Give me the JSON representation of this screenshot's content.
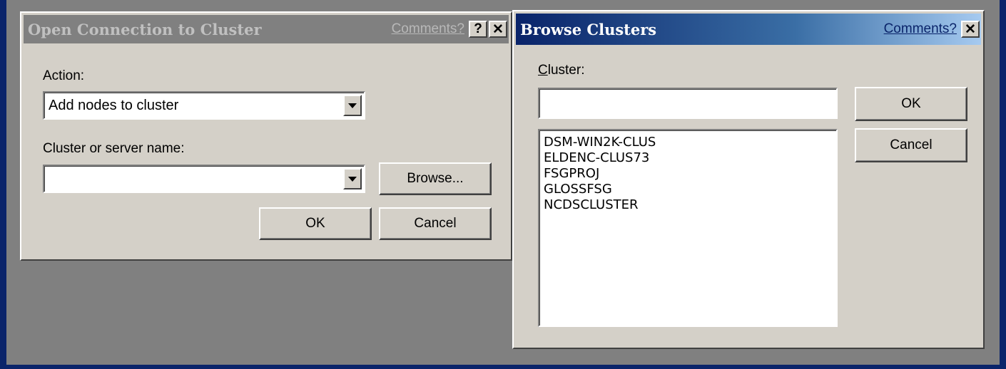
{
  "open_dialog": {
    "title": "Open Connection to Cluster",
    "comments_link": "Comments?",
    "help_button": "?",
    "close_button": "✕",
    "action_label": "Action:",
    "action_value": "Add nodes to cluster",
    "cluster_label": "Cluster or server name:",
    "cluster_value": "",
    "browse_label": "Browse...",
    "ok_label": "OK",
    "cancel_label": "Cancel"
  },
  "browse_dialog": {
    "title": "Browse Clusters",
    "comments_link": "Comments?",
    "close_button": "✕",
    "cluster_label_accel": "C",
    "cluster_label_rest": "luster:",
    "cluster_input_value": "",
    "ok_label": "OK",
    "cancel_label": "Cancel",
    "clusters": [
      "DSM-WIN2K-CLUS",
      "ELDENC-CLUS73",
      "FSGPROJ",
      "GLOSSFSG",
      "NCDSCLUSTER"
    ]
  }
}
